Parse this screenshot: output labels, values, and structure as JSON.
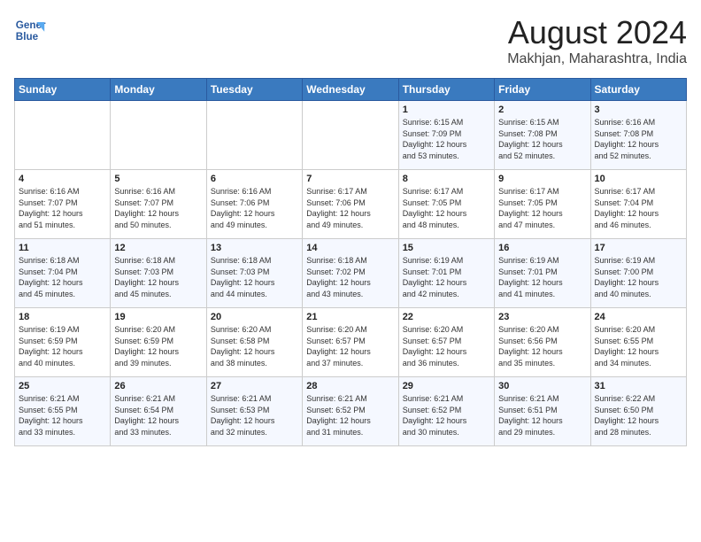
{
  "logo": {
    "line1": "General",
    "line2": "Blue"
  },
  "title": "August 2024",
  "location": "Makhjan, Maharashtra, India",
  "days_of_week": [
    "Sunday",
    "Monday",
    "Tuesday",
    "Wednesday",
    "Thursday",
    "Friday",
    "Saturday"
  ],
  "weeks": [
    [
      {
        "day": "",
        "info": ""
      },
      {
        "day": "",
        "info": ""
      },
      {
        "day": "",
        "info": ""
      },
      {
        "day": "",
        "info": ""
      },
      {
        "day": "1",
        "info": "Sunrise: 6:15 AM\nSunset: 7:09 PM\nDaylight: 12 hours\nand 53 minutes."
      },
      {
        "day": "2",
        "info": "Sunrise: 6:15 AM\nSunset: 7:08 PM\nDaylight: 12 hours\nand 52 minutes."
      },
      {
        "day": "3",
        "info": "Sunrise: 6:16 AM\nSunset: 7:08 PM\nDaylight: 12 hours\nand 52 minutes."
      }
    ],
    [
      {
        "day": "4",
        "info": "Sunrise: 6:16 AM\nSunset: 7:07 PM\nDaylight: 12 hours\nand 51 minutes."
      },
      {
        "day": "5",
        "info": "Sunrise: 6:16 AM\nSunset: 7:07 PM\nDaylight: 12 hours\nand 50 minutes."
      },
      {
        "day": "6",
        "info": "Sunrise: 6:16 AM\nSunset: 7:06 PM\nDaylight: 12 hours\nand 49 minutes."
      },
      {
        "day": "7",
        "info": "Sunrise: 6:17 AM\nSunset: 7:06 PM\nDaylight: 12 hours\nand 49 minutes."
      },
      {
        "day": "8",
        "info": "Sunrise: 6:17 AM\nSunset: 7:05 PM\nDaylight: 12 hours\nand 48 minutes."
      },
      {
        "day": "9",
        "info": "Sunrise: 6:17 AM\nSunset: 7:05 PM\nDaylight: 12 hours\nand 47 minutes."
      },
      {
        "day": "10",
        "info": "Sunrise: 6:17 AM\nSunset: 7:04 PM\nDaylight: 12 hours\nand 46 minutes."
      }
    ],
    [
      {
        "day": "11",
        "info": "Sunrise: 6:18 AM\nSunset: 7:04 PM\nDaylight: 12 hours\nand 45 minutes."
      },
      {
        "day": "12",
        "info": "Sunrise: 6:18 AM\nSunset: 7:03 PM\nDaylight: 12 hours\nand 45 minutes."
      },
      {
        "day": "13",
        "info": "Sunrise: 6:18 AM\nSunset: 7:03 PM\nDaylight: 12 hours\nand 44 minutes."
      },
      {
        "day": "14",
        "info": "Sunrise: 6:18 AM\nSunset: 7:02 PM\nDaylight: 12 hours\nand 43 minutes."
      },
      {
        "day": "15",
        "info": "Sunrise: 6:19 AM\nSunset: 7:01 PM\nDaylight: 12 hours\nand 42 minutes."
      },
      {
        "day": "16",
        "info": "Sunrise: 6:19 AM\nSunset: 7:01 PM\nDaylight: 12 hours\nand 41 minutes."
      },
      {
        "day": "17",
        "info": "Sunrise: 6:19 AM\nSunset: 7:00 PM\nDaylight: 12 hours\nand 40 minutes."
      }
    ],
    [
      {
        "day": "18",
        "info": "Sunrise: 6:19 AM\nSunset: 6:59 PM\nDaylight: 12 hours\nand 40 minutes."
      },
      {
        "day": "19",
        "info": "Sunrise: 6:20 AM\nSunset: 6:59 PM\nDaylight: 12 hours\nand 39 minutes."
      },
      {
        "day": "20",
        "info": "Sunrise: 6:20 AM\nSunset: 6:58 PM\nDaylight: 12 hours\nand 38 minutes."
      },
      {
        "day": "21",
        "info": "Sunrise: 6:20 AM\nSunset: 6:57 PM\nDaylight: 12 hours\nand 37 minutes."
      },
      {
        "day": "22",
        "info": "Sunrise: 6:20 AM\nSunset: 6:57 PM\nDaylight: 12 hours\nand 36 minutes."
      },
      {
        "day": "23",
        "info": "Sunrise: 6:20 AM\nSunset: 6:56 PM\nDaylight: 12 hours\nand 35 minutes."
      },
      {
        "day": "24",
        "info": "Sunrise: 6:20 AM\nSunset: 6:55 PM\nDaylight: 12 hours\nand 34 minutes."
      }
    ],
    [
      {
        "day": "25",
        "info": "Sunrise: 6:21 AM\nSunset: 6:55 PM\nDaylight: 12 hours\nand 33 minutes."
      },
      {
        "day": "26",
        "info": "Sunrise: 6:21 AM\nSunset: 6:54 PM\nDaylight: 12 hours\nand 33 minutes."
      },
      {
        "day": "27",
        "info": "Sunrise: 6:21 AM\nSunset: 6:53 PM\nDaylight: 12 hours\nand 32 minutes."
      },
      {
        "day": "28",
        "info": "Sunrise: 6:21 AM\nSunset: 6:52 PM\nDaylight: 12 hours\nand 31 minutes."
      },
      {
        "day": "29",
        "info": "Sunrise: 6:21 AM\nSunset: 6:52 PM\nDaylight: 12 hours\nand 30 minutes."
      },
      {
        "day": "30",
        "info": "Sunrise: 6:21 AM\nSunset: 6:51 PM\nDaylight: 12 hours\nand 29 minutes."
      },
      {
        "day": "31",
        "info": "Sunrise: 6:22 AM\nSunset: 6:50 PM\nDaylight: 12 hours\nand 28 minutes."
      }
    ]
  ]
}
